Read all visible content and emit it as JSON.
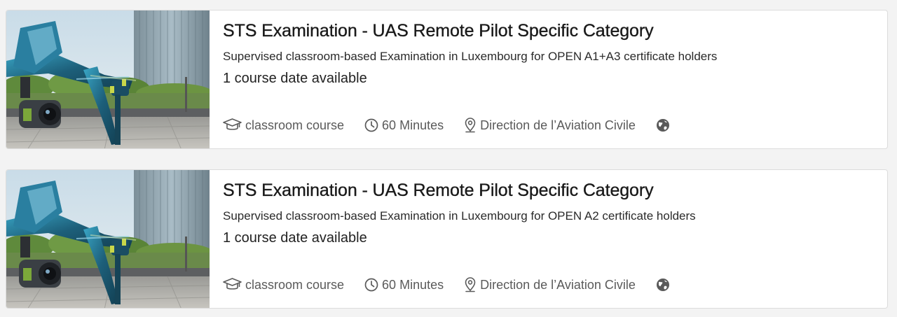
{
  "courses": [
    {
      "title": "STS Examination - UAS Remote Pilot Specific Category",
      "subtitle": "Supervised classroom-based Examination in Luxembourg for OPEN A1+A3 certificate holders",
      "dates": "1 course date available",
      "format": "classroom course",
      "duration": "60 Minutes",
      "location": "Direction de l’Aviation Civile",
      "format_icon": "graduation-cap-icon",
      "duration_icon": "clock-icon",
      "location_icon": "map-pin-icon",
      "language_icon": "globe-icon"
    },
    {
      "title": "STS Examination - UAS Remote Pilot Specific Category",
      "subtitle": "Supervised classroom-based Examination in Luxembourg for OPEN A2 certificate holders",
      "dates": "1 course date available",
      "format": "classroom course",
      "duration": "60 Minutes",
      "location": "Direction de l’Aviation Civile",
      "format_icon": "graduation-cap-icon",
      "duration_icon": "clock-icon",
      "location_icon": "map-pin-icon",
      "language_icon": "globe-icon"
    }
  ],
  "colors": {
    "page_background": "#f3f3f3",
    "card_background": "#ffffff",
    "card_border": "#dcdcdc",
    "title": "#1a1a1a",
    "meta_text": "#5a5a5a",
    "drone_body": "#1f6f8f",
    "sky": "#cfe0ea"
  }
}
